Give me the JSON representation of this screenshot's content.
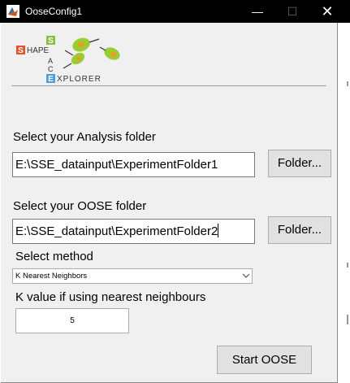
{
  "window": {
    "title": "OoseConfig1",
    "minimize_glyph": "—",
    "maximize_glyph": "☐",
    "close_glyph": "✕"
  },
  "logo": {
    "icon": "shape-space-explorer-logo",
    "lines": [
      "SHAPE",
      "SPACE",
      "EXPLORER"
    ],
    "colors": {
      "s": "#e8532a",
      "p": "#8cbf3f",
      "a": "#2f8fcf",
      "c": "#f2a21f",
      "e": "#4a9fd8",
      "blob": "#9acd32",
      "spot": "#e89a2a"
    }
  },
  "analysis": {
    "label": "Select your Analysis folder",
    "path": "E:\\SSE_datainput\\ExperimentFolder1",
    "button": "Folder..."
  },
  "oose": {
    "label": "Select your OOSE folder",
    "path": "E:\\SSE_datainput\\ExperimentFolder2",
    "button": "Folder..."
  },
  "method": {
    "label": "Select method",
    "selected": "K Nearest Neighbors"
  },
  "k": {
    "label": "K value if using nearest neighbours",
    "value": "5"
  },
  "start_button": "Start OOSE",
  "colors": {
    "titlebar": "#000000",
    "panel": "#f0f0f0",
    "button": "#e1e1e1"
  }
}
